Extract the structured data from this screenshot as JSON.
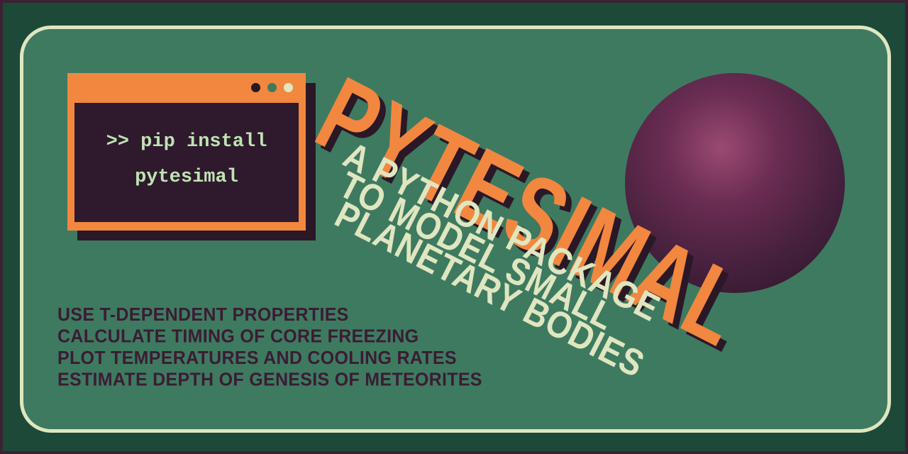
{
  "terminal": {
    "line1": ">> pip install",
    "line2": "pytesimal"
  },
  "title": "PYTESIMAL",
  "subtitle_lines": [
    "A PYTHON PACKAGE",
    "TO MODEL SMALL",
    "PLANETARY BODIES",
    ""
  ],
  "features": [
    "USE T-DEPENDENT PROPERTIES",
    "CALCULATE TIMING OF CORE FREEZING",
    "PLOT TEMPERATURES AND COOLING RATES",
    "ESTIMATE DEPTH OF GENESIS OF METEORITES"
  ],
  "colors": {
    "background": "#1d4a38",
    "panel": "#3e7a60",
    "orange": "#f2873f",
    "cream": "#dfe6c0",
    "plum": "#3a1c33"
  }
}
